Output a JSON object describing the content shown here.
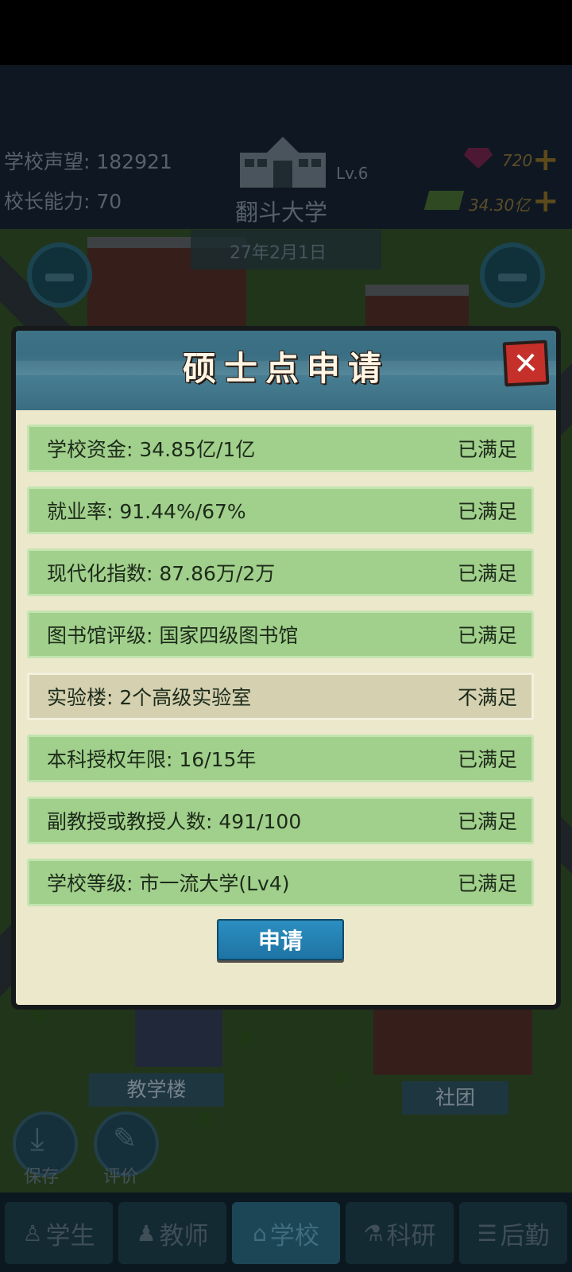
{
  "hud": {
    "reputation_label": "学校声望: 182921",
    "ability_label": "校长能力: 70",
    "school_name": "翻斗大学",
    "school_level": "Lv.6",
    "date": "27年2月1日",
    "gems": "720",
    "money": "34.30亿"
  },
  "map_labels": {
    "teaching_building": "教学楼",
    "club": "社团",
    "save": "保存",
    "review": "评价"
  },
  "modal": {
    "title": "硕士点申请",
    "close_icon": "close-x-icon",
    "requirements": [
      {
        "label": "学校资金: 34.85亿/1亿",
        "status": "已满足"
      },
      {
        "label": "就业率: 91.44%/67%",
        "status": "已满足"
      },
      {
        "label": "现代化指数: 87.86万/2万",
        "status": "已满足"
      },
      {
        "label": "图书馆评级: 国家四级图书馆",
        "status": "已满足"
      },
      {
        "label": "实验楼: 2个高级实验室",
        "status": "不满足"
      },
      {
        "label": "本科授权年限: 16/15年",
        "status": "已满足"
      },
      {
        "label": "副教授或教授人数: 491/100",
        "status": "已满足"
      },
      {
        "label": "学校等级: 市一流大学(Lv4)",
        "status": "已满足"
      }
    ],
    "apply_label": "申请"
  },
  "bottom_nav": [
    {
      "label": "学生",
      "icon": "student-icon"
    },
    {
      "label": "教师",
      "icon": "teacher-icon"
    },
    {
      "label": "学校",
      "icon": "school-icon",
      "active": true
    },
    {
      "label": "科研",
      "icon": "flask-icon"
    },
    {
      "label": "后勤",
      "icon": "clipboard-icon"
    }
  ],
  "colors": {
    "met_row": "#a1cf8c",
    "unmet_row": "#d4d0b0",
    "apply_button": "#1e74a4",
    "close_button": "#c6302a"
  }
}
